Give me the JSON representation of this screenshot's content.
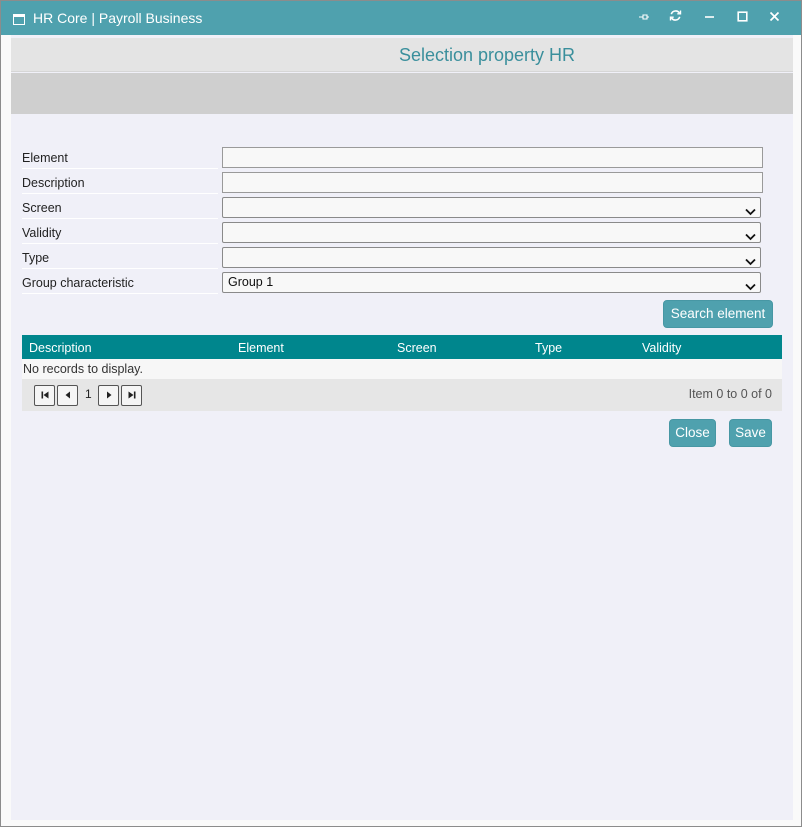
{
  "window": {
    "title": "HR Core | Payroll Business"
  },
  "header": {
    "title": "Selection property HR"
  },
  "form": {
    "element_label": "Element",
    "element_value": "",
    "description_label": "Description",
    "description_value": "",
    "screen_label": "Screen",
    "screen_value": "",
    "validity_label": "Validity",
    "validity_value": "",
    "type_label": "Type",
    "type_value": "",
    "group_label": "Group characteristic",
    "group_value": "Group 1"
  },
  "actions": {
    "search_label": "Search element",
    "close_label": "Close",
    "save_label": "Save"
  },
  "grid": {
    "columns": [
      "Description",
      "Element",
      "Screen",
      "Type",
      "Validity"
    ],
    "empty_message": "No records to display.",
    "page": "1",
    "info": "Item 0 to 0 of 0"
  },
  "colors": {
    "accent": "#4fa1ae",
    "grid_header": "#00868d",
    "background": "#f0f0f8"
  }
}
